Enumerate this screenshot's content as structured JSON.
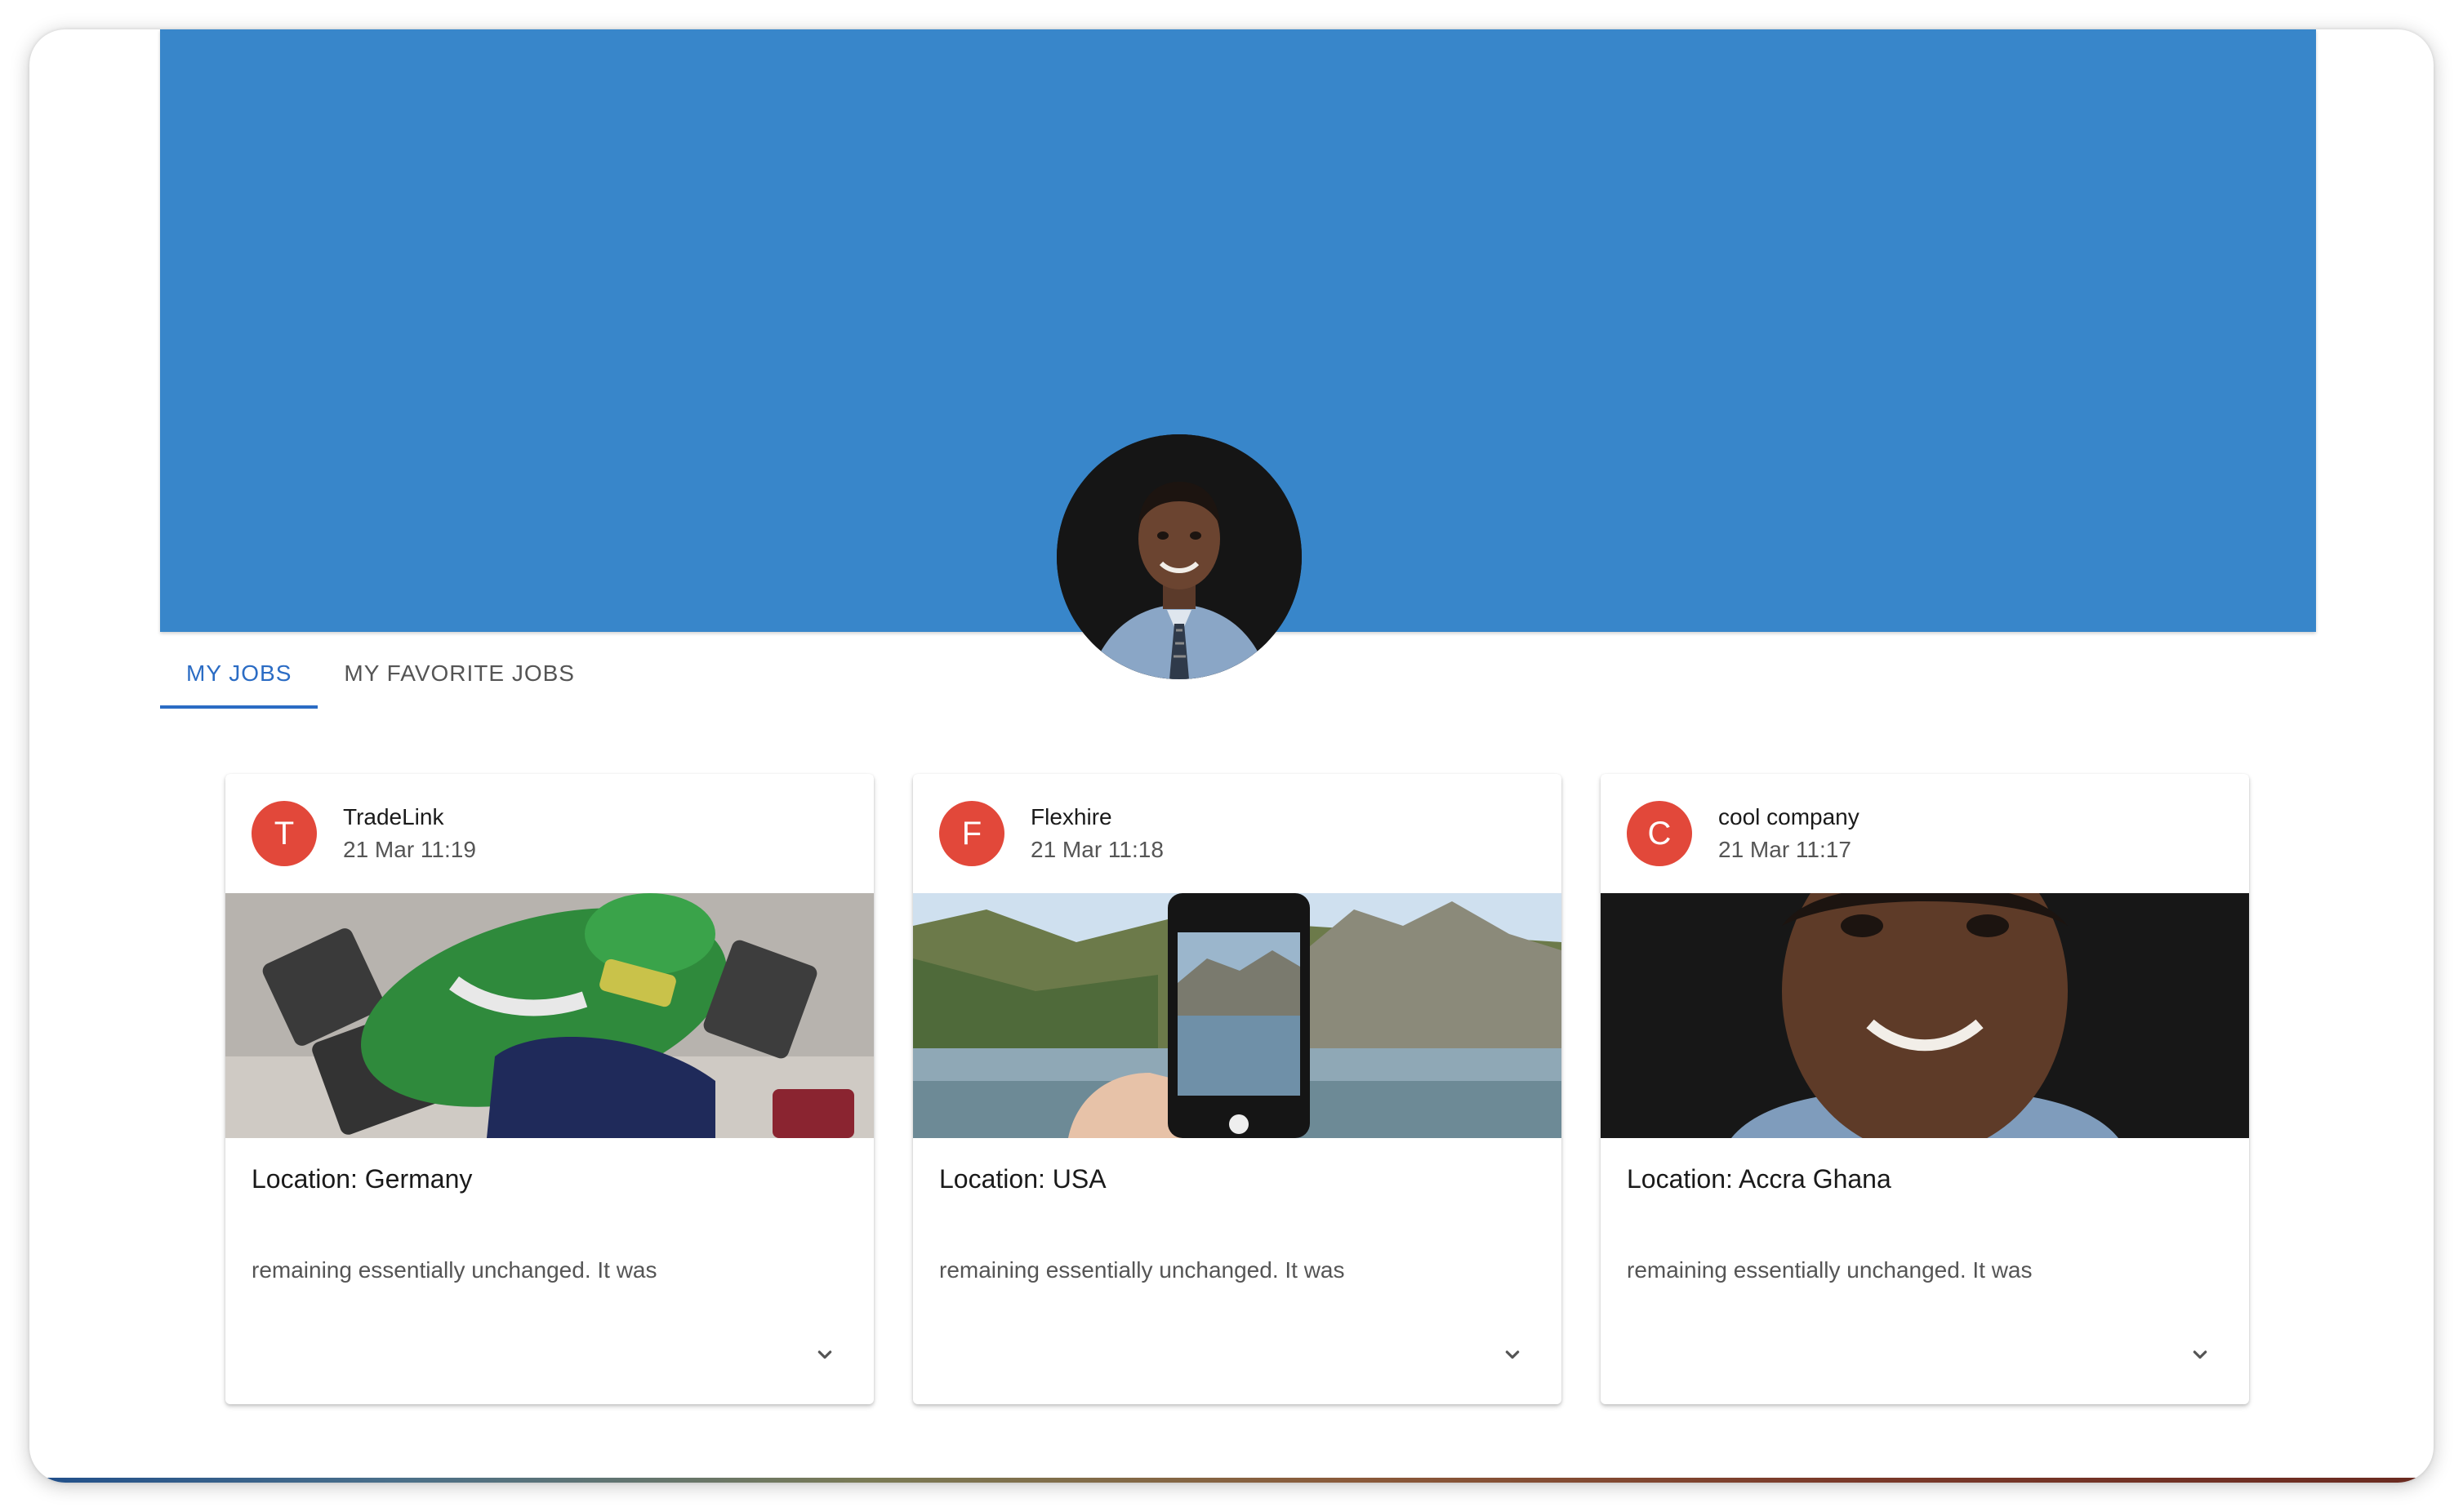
{
  "tabs": [
    {
      "label": "MY JOBS",
      "active": true
    },
    {
      "label": "MY FAVORITE JOBS",
      "active": false
    }
  ],
  "banner": {
    "color": "#3886ca"
  },
  "accent_color": "#2b6cc4",
  "avatar_color": "#e2483a",
  "cards": [
    {
      "initial": "T",
      "company": "TradeLink",
      "date": "21 Mar 11:19",
      "image_icon": "toy-figure-dumbbell-image",
      "location": "Location: Germany",
      "description": "remaining essentially unchanged. It was"
    },
    {
      "initial": "F",
      "company": "Flexhire",
      "date": "21 Mar 11:18",
      "image_icon": "phone-lake-mountain-image",
      "location": "Location: USA",
      "description": "remaining essentially unchanged. It was"
    },
    {
      "initial": "C",
      "company": "cool company",
      "date": "21 Mar 11:17",
      "image_icon": "portrait-man-image",
      "location": "Location: Accra Ghana",
      "description": "remaining essentially unchanged. It was"
    }
  ]
}
